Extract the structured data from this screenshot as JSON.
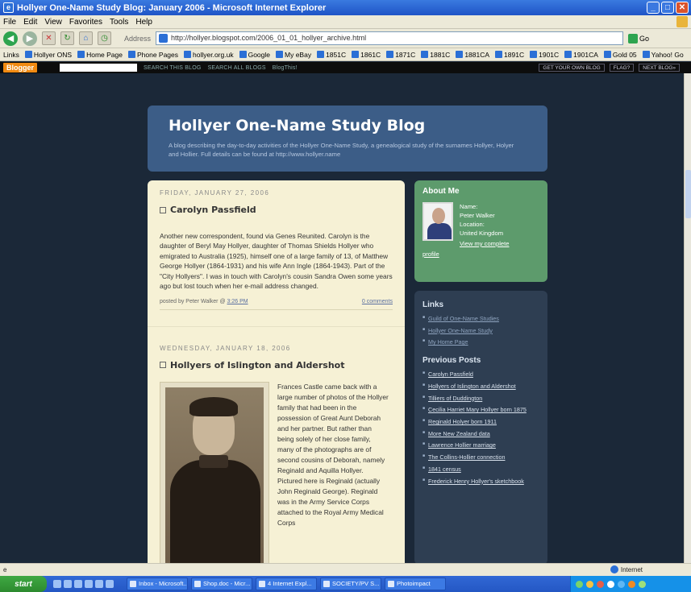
{
  "window": {
    "title": "Hollyer One-Name Study Blog: January 2006 - Microsoft Internet Explorer"
  },
  "menu": [
    "File",
    "Edit",
    "View",
    "Favorites",
    "Tools",
    "Help"
  ],
  "toolbar": {
    "address_label": "Address",
    "address_value": "http://hollyer.blogspot.com/2006_01_01_hollyer_archive.html",
    "go_label": "Go"
  },
  "links_bar": {
    "label": "Links",
    "items": [
      "Hollyer ONS",
      "Home Page",
      "Phone Pages",
      "hollyer.org.uk",
      "Google",
      "My eBay",
      "1851C",
      "1861C",
      "1871C",
      "1881C",
      "1881CA",
      "1891C",
      "1901C",
      "1901CA",
      "Gold 05",
      "Yahoo! Go"
    ]
  },
  "blogger_nav": {
    "logo": "Blogger",
    "search_this": "SEARCH THIS BLOG",
    "search_all": "SEARCH ALL BLOGS",
    "blog_this": "BlogThis!",
    "get_own": "GET YOUR OWN BLOG",
    "flag": "FLAG?",
    "next_blog": "NEXT BLOG»"
  },
  "blog": {
    "title": "Hollyer One-Name Study Blog",
    "description": "A blog describing the day-to-day activities of the Hollyer One-Name Study, a genealogical study of the surnames Hollyer, Holyer and Hollier. Full details can be found at http://www.hollyer.name"
  },
  "post1": {
    "date": "FRIDAY, JANUARY 27, 2006",
    "title": "Carolyn Passfield",
    "body": "Another new correspondent, found via Genes Reunited. Carolyn is the daughter of Beryl May Hollyer, daughter of Thomas Shields Hollyer who emigrated to Australia (1925), himself one of a large family of 13, of Matthew George Hollyer (1864-1931) and his wife Ann Ingle (1864-1943). Part of the \"City Hollyers\". I was in touch with Carolyn's cousin Sandra Owen some years ago but lost touch when her e-mail address changed.",
    "posted_by": "posted by Peter Walker @",
    "time": "3:26 PM",
    "comments": "0 comments"
  },
  "post2": {
    "date": "WEDNESDAY, JANUARY 18, 2006",
    "title": "Hollyers of Islington and Aldershot",
    "body": "Frances Castle came back with a large number of photos of the Hollyer family that had been in the possession of Great Aunt Deborah and her partner. But rather than being solely of her close family, many of the photographs are of second cousins of Deborah, namely Reginald and Aquilla Hollyer. Pictured here is Reginald (actually John Reginald George). Reginald was in the Army Service Corps attached to the Royal Army Medical Corps"
  },
  "about": {
    "heading": "About Me",
    "name_label": "Name:",
    "name": "Peter Walker",
    "location_label": "Location:",
    "location": "United Kingdom",
    "view_profile": "View my complete",
    "profile_word": "profile"
  },
  "links": {
    "heading": "Links",
    "items": [
      "Guild of One-Name Studies",
      "Hollyer One-Name Study",
      "My Home Page"
    ]
  },
  "previous_posts": {
    "heading": "Previous Posts",
    "items": [
      "Carolyn Passfield",
      "Hollyers of Islington and Aldershot",
      "Tilliers of Duddington",
      "Cecilia Harriet Mary Hollyer born 1875",
      "Reginald Holyer born 1911",
      "More New Zealand data",
      "Lawrence Hollier marriage",
      "The Collins-Hollier connection",
      "1841 census",
      "Frederick Henry Hollyer's sketchbook"
    ]
  },
  "status": {
    "zone": "Internet"
  },
  "taskbar": {
    "start": "start",
    "tasks": [
      "Inbox - Microsoft...",
      "Shop.doc - Micr...",
      "4 Internet Expl...",
      "SOCIETY/PV S...",
      "Photoimpact"
    ]
  }
}
